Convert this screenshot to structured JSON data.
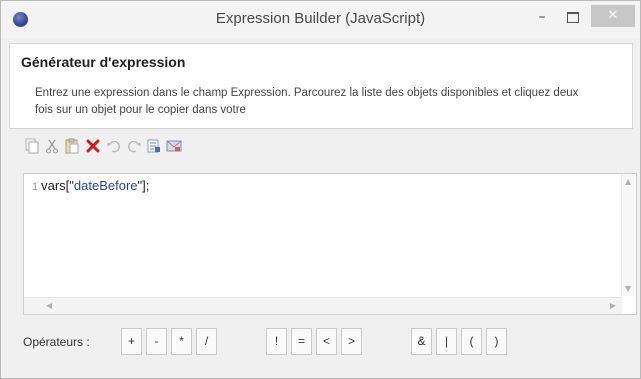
{
  "window": {
    "title": "Expression Builder (JavaScript)",
    "minimize": "–",
    "close": "✕"
  },
  "header": {
    "title": "Générateur d'expression",
    "description": "Entrez une expression dans le champ Expression. Parcourez la liste des objets disponibles et cliquez deux fois sur un objet pour le copier dans votre"
  },
  "toolbar": {
    "icons": [
      "copy-icon",
      "cut-icon",
      "paste-icon",
      "delete-icon",
      "undo-icon",
      "redo-icon",
      "format-icon",
      "test-icon"
    ]
  },
  "editor": {
    "line_number": "1",
    "code_prefix": "vars[\"",
    "code_string": "dateBefore",
    "code_suffix": "\"];"
  },
  "operators": {
    "label": "Opérateurs :",
    "buttons": [
      "+",
      "-",
      "*",
      "/",
      "!",
      "=",
      "<",
      ">",
      "&",
      "|",
      "(",
      ")"
    ]
  }
}
